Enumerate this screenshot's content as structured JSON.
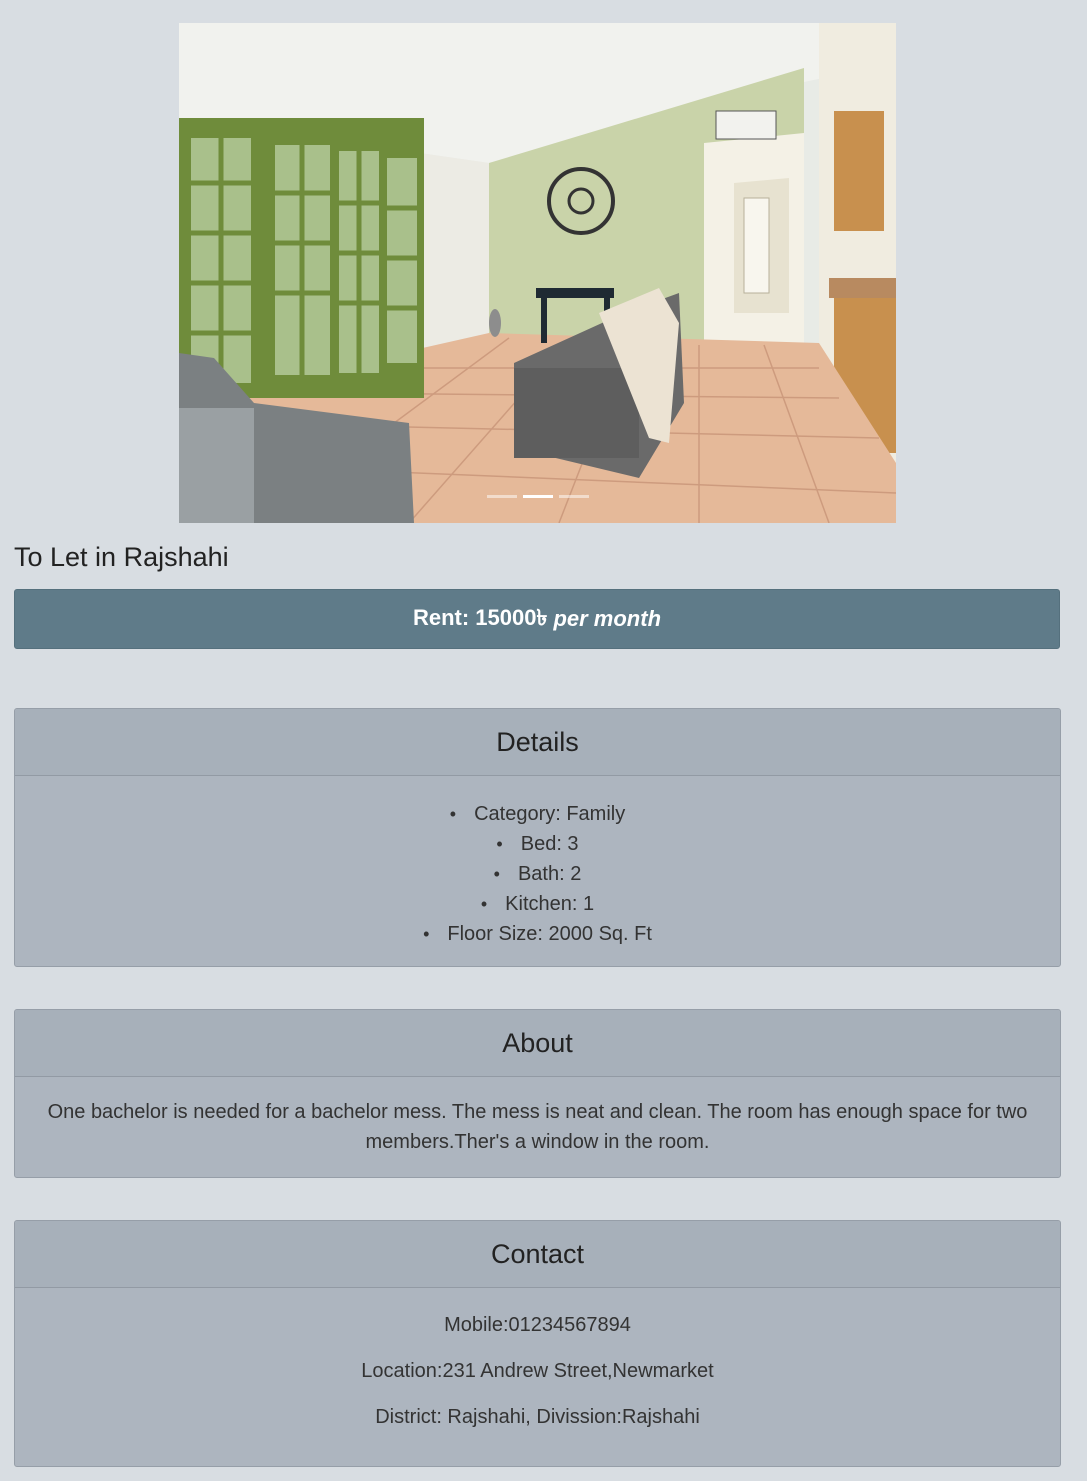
{
  "carousel": {
    "image_alt": "Living room with green french doors, tiled floor and gray sofas",
    "slide_count": 3,
    "active_slide": 2
  },
  "listing": {
    "title": "To Let in Rajshahi",
    "rent_prefix": "Rent: 15000৳",
    "rent_suffix": "per month"
  },
  "details": {
    "heading": "Details",
    "items": [
      "Category: Family",
      "Bed: 3",
      "Bath: 2",
      "Kitchen: 1",
      "Floor Size: 2000 Sq. Ft"
    ]
  },
  "about": {
    "heading": "About",
    "text": "One bachelor is needed for a bachelor mess. The mess is neat and clean. The room has enough space for two members.Ther's a window in the room."
  },
  "contact": {
    "heading": "Contact",
    "mobile": "Mobile:01234567894",
    "location": "Location:231 Andrew Street,Newmarket",
    "district": "District: Rajshahi, Divission:Rajshahi"
  },
  "colors": {
    "page_bg": "#d8dde2",
    "rent_bar": "#5f7b89",
    "card_bg": "#adb5bf",
    "card_header_bg": "#a7b0ba"
  }
}
